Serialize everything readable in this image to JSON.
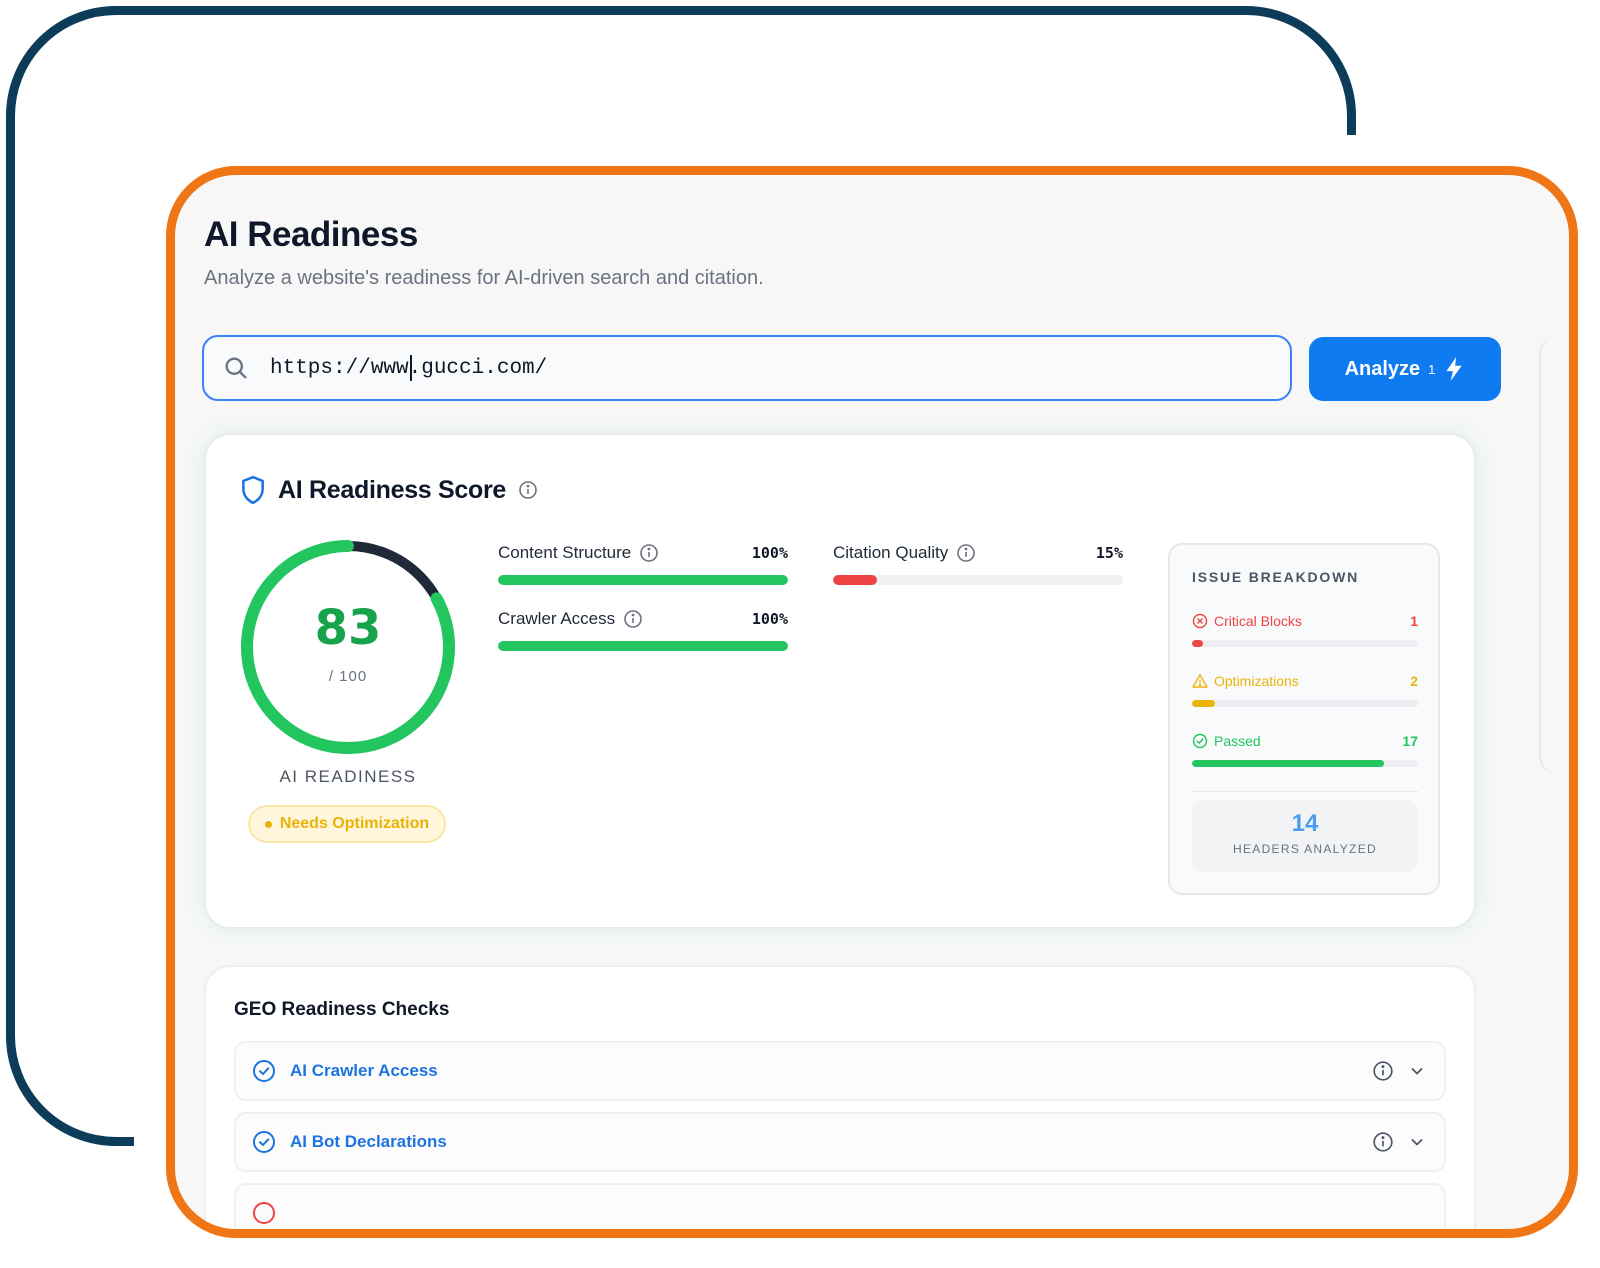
{
  "header": {
    "title": "AI Readiness",
    "subtitle": "Analyze a website's readiness for AI-driven search and citation."
  },
  "search": {
    "value": "https://www.gucci.com/",
    "button_label": "Analyze",
    "button_count": "1"
  },
  "score_card": {
    "title": "AI Readiness Score",
    "score": "83",
    "score_max": "/ 100",
    "score_fraction": 0.83,
    "caption": "AI READINESS",
    "status": "Needs Optimization",
    "metrics": [
      {
        "name": "Content Structure",
        "pct": "100%",
        "value": 100,
        "color": "#22c55e"
      },
      {
        "name": "Citation Quality",
        "pct": "15%",
        "value": 15,
        "color": "#ef4444"
      },
      {
        "name": "Crawler Access",
        "pct": "100%",
        "value": 100,
        "color": "#22c55e"
      }
    ]
  },
  "issue_breakdown": {
    "title": "ISSUE BREAKDOWN",
    "items": [
      {
        "label": "Critical Blocks",
        "count": "1",
        "value": 1,
        "color": "#ef4444"
      },
      {
        "label": "Optimizations",
        "count": "2",
        "value": 2,
        "color": "#eab308"
      },
      {
        "label": "Passed",
        "count": "17",
        "value": 17,
        "color": "#22c55e"
      }
    ],
    "headers_value": "14",
    "headers_label": "HEADERS ANALYZED"
  },
  "checks": {
    "title": "GEO Readiness Checks",
    "items": [
      {
        "label": "AI Crawler Access"
      },
      {
        "label": "AI Bot Declarations"
      },
      {
        "label": ""
      }
    ]
  },
  "colors": {
    "accent": "#0f7bf0",
    "success": "#22c55e",
    "warning": "#eab308",
    "danger": "#ef4444",
    "frame_navy": "#0d3c5a",
    "frame_orange": "#ef7515"
  }
}
